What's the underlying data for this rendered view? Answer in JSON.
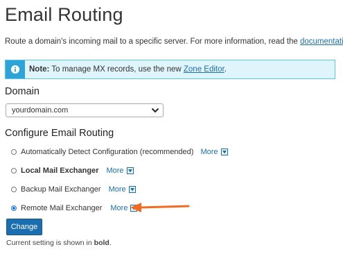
{
  "page": {
    "title": "Email Routing",
    "intro_text": "Route a domain's incoming mail to a specific server. For more information, read the",
    "intro_link": "documentation",
    "intro_end": "."
  },
  "notice": {
    "icon": "info-icon",
    "label": "Note:",
    "text": "To manage MX records, use the new",
    "link": "Zone Editor",
    "end": ".",
    "color_border": "#5bc5e6",
    "color_bg": "#dff4fb"
  },
  "domain": {
    "label": "Domain",
    "selected": "yourdomain.com"
  },
  "config": {
    "label": "Configure Email Routing",
    "options": [
      {
        "label": "Automatically Detect Configuration (recommended)",
        "more": "More",
        "checked": false,
        "bold": false
      },
      {
        "label": "Local Mail Exchanger",
        "more": "More",
        "checked": false,
        "bold": true
      },
      {
        "label": "Backup Mail Exchanger",
        "more": "More",
        "checked": false,
        "bold": false
      },
      {
        "label": "Remote Mail Exchanger",
        "more": "More",
        "checked": true,
        "bold": false
      }
    ]
  },
  "actions": {
    "change_label": "Change",
    "button_color": "#1b6fb0"
  },
  "footnote": {
    "before": "Current setting is shown in",
    "bold": "bold",
    "after": "."
  },
  "annotation": {
    "arrow_color": "#f26b21",
    "icon": "arrow-left-icon"
  }
}
